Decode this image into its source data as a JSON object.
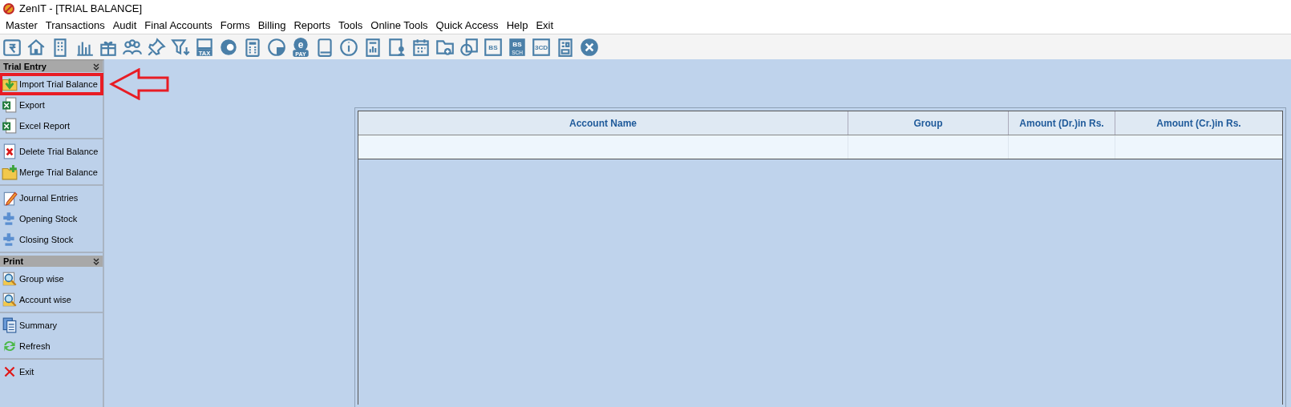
{
  "window": {
    "title": "ZenIT - [TRIAL BALANCE]"
  },
  "menu": [
    "Master",
    "Transactions",
    "Audit",
    "Final Accounts",
    "Forms",
    "Billing",
    "Reports",
    "Tools",
    "Online Tools",
    "Quick Access",
    "Help",
    "Exit"
  ],
  "toolbar": [
    {
      "kind": "rupee"
    },
    {
      "kind": "home"
    },
    {
      "kind": "building"
    },
    {
      "kind": "bars"
    },
    {
      "kind": "gift"
    },
    {
      "kind": "people"
    },
    {
      "kind": "pin"
    },
    {
      "kind": "filter"
    },
    {
      "kind": "tax",
      "texts": [
        "TAX"
      ]
    },
    {
      "kind": "disc"
    },
    {
      "kind": "calculator"
    },
    {
      "kind": "pie"
    },
    {
      "kind": "epay",
      "texts": [
        "e",
        "PAY"
      ]
    },
    {
      "kind": "book"
    },
    {
      "kind": "info"
    },
    {
      "kind": "report"
    },
    {
      "kind": "person"
    },
    {
      "kind": "calendar"
    },
    {
      "kind": "folder"
    },
    {
      "kind": "copy"
    },
    {
      "kind": "tile",
      "texts": [
        "BS"
      ]
    },
    {
      "kind": "tile2",
      "texts": [
        "BS",
        "SCH"
      ]
    },
    {
      "kind": "tile",
      "texts": [
        "3CD"
      ]
    },
    {
      "kind": "sheet"
    },
    {
      "kind": "close"
    }
  ],
  "sidebar": [
    {
      "title": "Trial Entry",
      "groups": [
        [
          {
            "label": "Import Trial Balance",
            "kind": "import",
            "highlighted": true
          },
          {
            "label": "Export",
            "kind": "excel",
            "highlighted": false
          },
          {
            "label": "Excel Report",
            "kind": "excel",
            "highlighted": false
          }
        ],
        [
          {
            "label": "Delete Trial Balance",
            "kind": "delete",
            "highlighted": false
          },
          {
            "label": "Merge Trial Balance",
            "kind": "merge",
            "highlighted": false
          }
        ],
        [
          {
            "label": "Journal Entries",
            "kind": "journal",
            "highlighted": false
          },
          {
            "label": "Opening Stock",
            "kind": "stock",
            "highlighted": false
          },
          {
            "label": "Closing Stock",
            "kind": "stock",
            "highlighted": false
          }
        ]
      ]
    },
    {
      "title": "Print",
      "groups": [
        [
          {
            "label": "Group wise",
            "kind": "preview",
            "highlighted": false
          },
          {
            "label": "Account wise",
            "kind": "preview",
            "highlighted": false
          }
        ],
        [
          {
            "label": "Summary",
            "kind": "summary",
            "highlighted": false
          },
          {
            "label": "Refresh",
            "kind": "refresh",
            "highlighted": false
          }
        ],
        [
          {
            "label": "Exit",
            "kind": "exit",
            "highlighted": false
          }
        ]
      ]
    }
  ],
  "table": {
    "columns": [
      "Account Name",
      "Group",
      "Amount (Dr.)in Rs.",
      "Amount (Cr.)in Rs."
    ]
  }
}
